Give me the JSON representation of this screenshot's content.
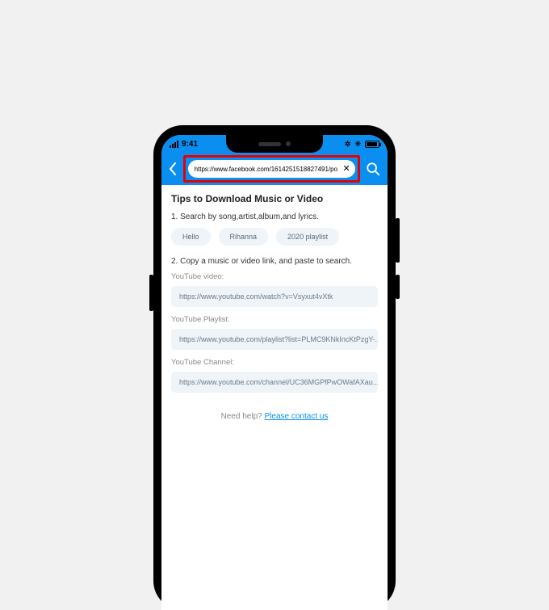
{
  "status": {
    "time": "9:41",
    "bluetooth_glyph": "✲",
    "wifi_glyph": "✳"
  },
  "nav": {
    "url": "https://www.facebook.com/1614251518827491/po"
  },
  "page": {
    "title": "Tips to Download Music or Video",
    "step1": "1. Search by song,artist,album,and lyrics.",
    "chips": [
      "Hello",
      "Rihanna",
      "2020 playlist"
    ],
    "step2": "2. Copy a music or video link, and paste to search.",
    "sections": [
      {
        "label": "YouTube video:",
        "link": "https://www.youtube.com/watch?v=Vsyxut4vXtk"
      },
      {
        "label": "YouTube Playlist:",
        "link": "https://www.youtube.com/playlist?list=PLMC9KNkIncKtPzgY-..."
      },
      {
        "label": "YouTube Channel:",
        "link": "https://www.youtube.com/channel/UC36MGPfPwOWafAXau..."
      }
    ],
    "help_prefix": "Need help? ",
    "help_link": "Please contact us"
  }
}
